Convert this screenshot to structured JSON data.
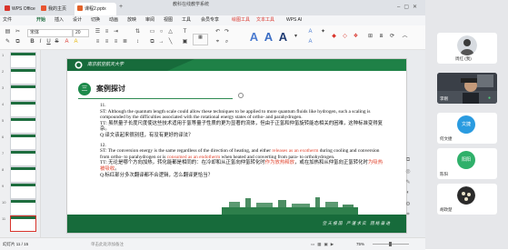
{
  "window": {
    "title": "教科在线教学系统",
    "tabs": [
      {
        "label": "WPS Office"
      },
      {
        "label": "我的主页"
      },
      {
        "label": "课程2.pptx"
      }
    ]
  },
  "menu": {
    "items": [
      "文件",
      "开始",
      "插入",
      "设计",
      "切换",
      "动画",
      "放映",
      "审阅",
      "视图",
      "工具",
      "会员专享",
      "绘图工具",
      "文本工具",
      "WPS AI"
    ],
    "active": "开始"
  },
  "toolbar": {
    "style_samples": [
      "A",
      "A",
      "A"
    ],
    "font_name": "宋体",
    "font_size": "20"
  },
  "thumbnails": [
    {
      "num": "1"
    },
    {
      "num": "2"
    },
    {
      "num": "3"
    },
    {
      "num": "4"
    },
    {
      "num": "5"
    },
    {
      "num": "6"
    },
    {
      "num": "7"
    },
    {
      "num": "8"
    },
    {
      "num": "9"
    },
    {
      "num": "10"
    },
    {
      "num": "11"
    }
  ],
  "slide": {
    "header_school": "南京航空航天大学",
    "badge": "三",
    "title": "案例探讨",
    "para11": {
      "num": "11.",
      "st": "ST: Although the quantum length scale could allow these techniques to be applied to more quantum fluids like hydrogen, such a scaling is compounded by the difficulties associated with the rotational energy states of ortho- and parahydrogen.",
      "tt": "TT: 虽然量子长度尺度使这些技术适用于氢等量子性质的更为显著的流体，但由于正氢和仲氢旋转能态相关的困难，这种标准变得复杂。",
      "q": "Q:译文该起来很别扭，有没有更好的译法？"
    },
    "para12": {
      "num": "12.",
      "st_a": "ST: The conversion energy is the same regardless of the direction of heating, and either ",
      "st_red1": "releases as an exotherm",
      "st_b": " during cooling and conversion from ortho- to parahydrogen or is ",
      "st_red2": "consumed as an endotherm",
      "st_c": " when heated and converting from para- to orthohydrogen.",
      "tt_a": "TT: 无论是哪个方向加热，转化能都是相同的：在冷却和从正氢向仲氢转化时",
      "tt_red1": "作为放热释放",
      "tt_b": "，或在加热和从仲氢向正氢转化时",
      "tt_red2": "为吸热被吸收",
      "tt_c": "。",
      "q": "Q:标红部分多次翻译都不合逻辑，怎么翻译更恰当？"
    },
    "footer": "空 天 报 国　严 谨 求 实　团 结 奋 进"
  },
  "statusbar": {
    "slide_indicator": "幻灯片 11 / 15",
    "notes_hint": "单击此处添加备注",
    "zoom": "75%"
  },
  "participants": [
    {
      "name": "周红 (我)",
      "initials": "",
      "color": "#ffffff"
    },
    {
      "name": "李刚",
      "initials": "",
      "color": "#2d3138"
    },
    {
      "name": "何文捷",
      "initials": "文捷",
      "color": "#2a9be0"
    },
    {
      "name": "陈阳",
      "initials": "阳阳",
      "color": "#2fb06a"
    },
    {
      "name": "胡政楚",
      "initials": "",
      "color": "#ffffff"
    }
  ]
}
